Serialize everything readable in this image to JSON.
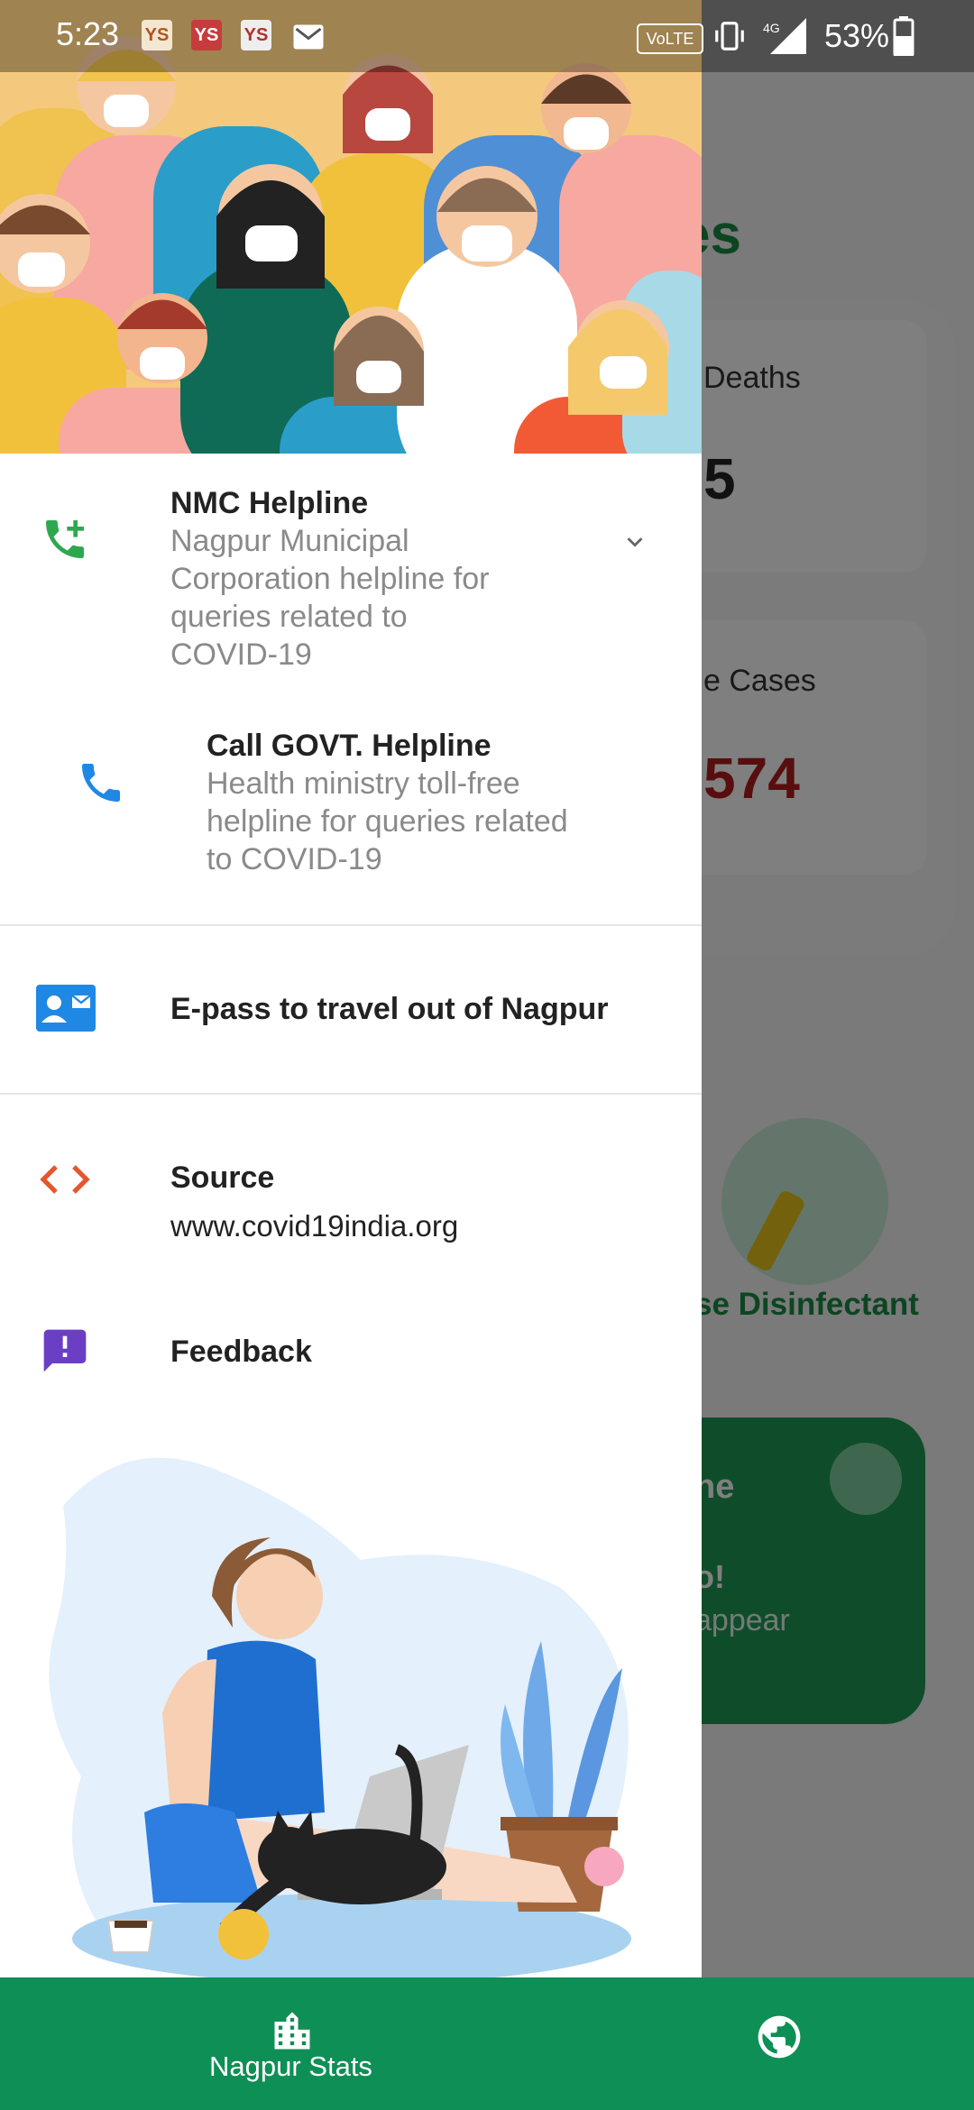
{
  "status_bar": {
    "time": "5:23",
    "badges": [
      "YS",
      "YS",
      "YS"
    ],
    "network_label": "VoLTE",
    "network_type": "4G",
    "battery": "53%",
    "icons": [
      "mail-icon",
      "vibrate-icon",
      "signal-icon",
      "battery-icon"
    ]
  },
  "background_app": {
    "section_title": "dates",
    "card_deaths_label": "Deaths",
    "card_deaths_value": "5",
    "card_active_label": "e Cases",
    "card_active_value": "574",
    "disinfectant_label": "se Disinfectant",
    "green_card_title": "ne",
    "green_card_line1": "o!",
    "green_card_line2": "appear",
    "colors": {
      "green": "#1b8a45",
      "red": "#8b1414"
    }
  },
  "drawer": {
    "items": [
      {
        "icon": "phone-add-icon",
        "title": "NMC Helpline",
        "subtitle": "Nagpur Municipal Corporation helpline for queries related to COVID-19",
        "subtitle_lines": [
          "Nagpur Municipal",
          "Corporation helpline for",
          "queries related to",
          "COVID-19"
        ],
        "expanded": true
      },
      {
        "icon": "phone-icon",
        "title": "Call GOVT. Helpline",
        "subtitle": "Health ministry toll-free helpline for queries related to COVID-19",
        "subtitle_lines": [
          "Health ministry toll-free",
          "helpline for queries related",
          "to COVID-19"
        ]
      },
      {
        "icon": "id-card-icon",
        "title": "E-pass to travel out of Nagpur"
      },
      {
        "icon": "code-icon",
        "title": "Source",
        "subtitle": "www.covid19india.org"
      },
      {
        "icon": "feedback-icon",
        "title": "Feedback"
      }
    ]
  },
  "bottom_nav": {
    "items": [
      {
        "icon": "city-icon",
        "label": "Nagpur Stats"
      },
      {
        "icon": "globe-icon",
        "label": ""
      }
    ]
  },
  "colors": {
    "brand_green": "#0e8f55",
    "phone_green": "#2ea84f",
    "phone_blue": "#1f88e5",
    "source_orange": "#e4572e",
    "feedback_purple": "#6b3fc4"
  }
}
